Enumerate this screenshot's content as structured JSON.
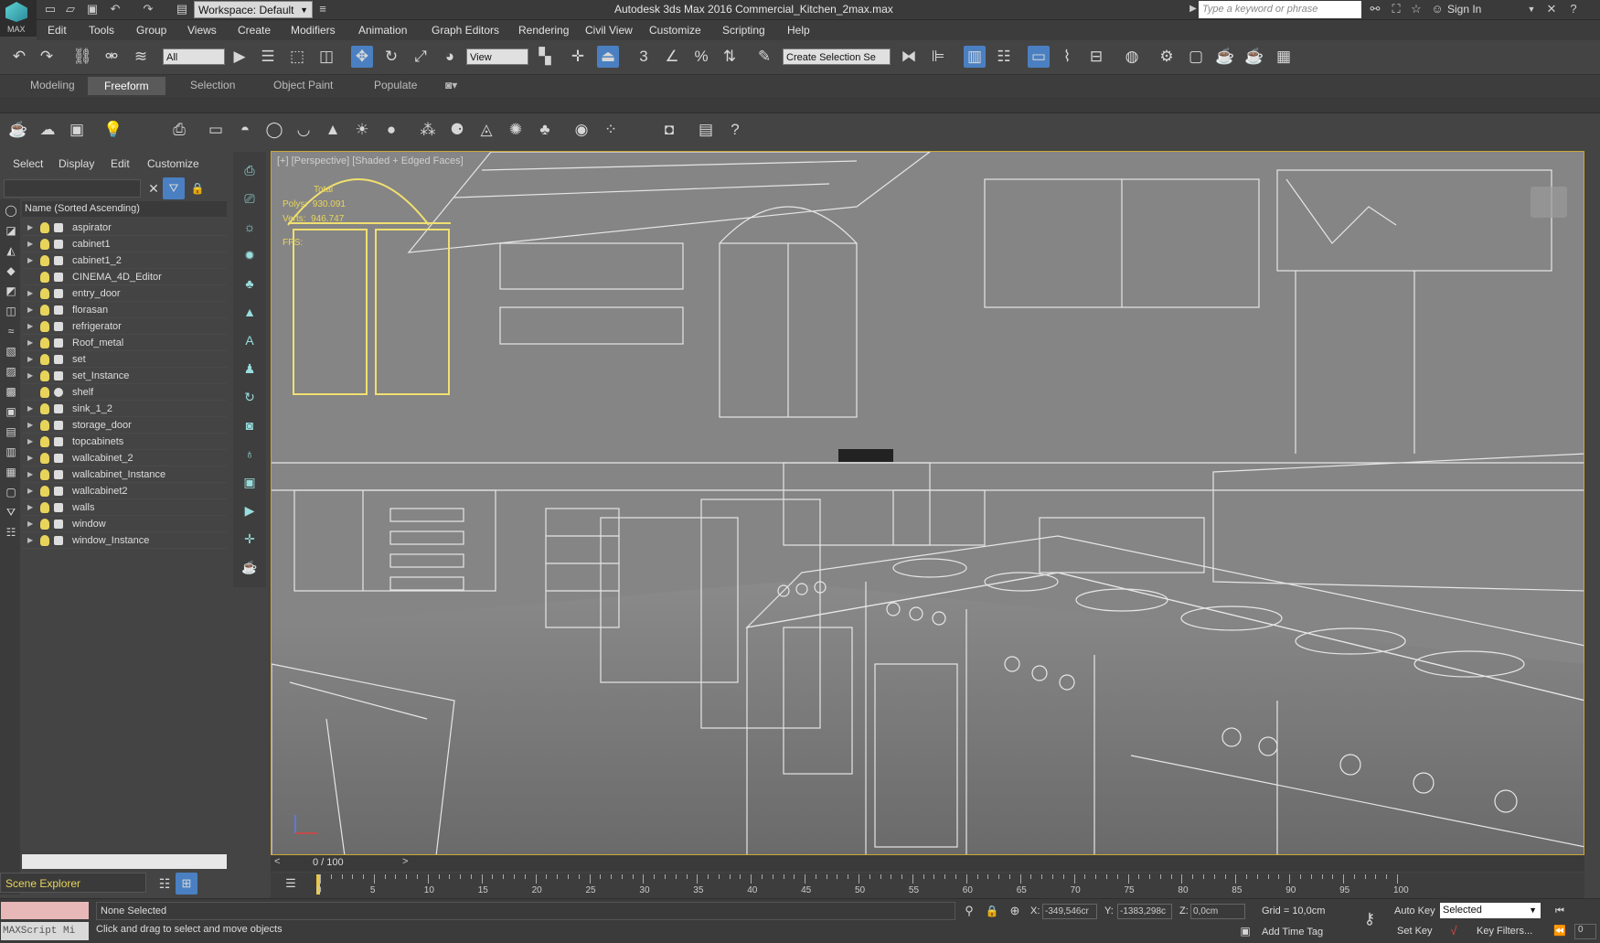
{
  "title_bar": {
    "app_logo_label": "MAX",
    "workspace": "Workspace: Default",
    "app_title": "Autodesk 3ds Max 2016     Commercial_Kitchen_2max.max",
    "search_placeholder": "Type a keyword or phrase",
    "sign_in": "Sign In"
  },
  "menu": [
    "Edit",
    "Tools",
    "Group",
    "Views",
    "Create",
    "Modifiers",
    "Animation",
    "Graph Editors",
    "Rendering",
    "Civil View",
    "Customize",
    "Scripting",
    "Help"
  ],
  "toolbar": {
    "selection_filter": "All",
    "ref_coord": "View",
    "named_selection_placeholder": "Create Selection Se",
    "snap_label": "3"
  },
  "ribbon_tabs": [
    "Modeling",
    "Freeform",
    "Selection",
    "Object Paint",
    "Populate"
  ],
  "ribbon_active": "Freeform",
  "explorer": {
    "tabs": [
      "Select",
      "Display",
      "Edit",
      "Customize"
    ],
    "column_header": "Name (Sorted Ascending)",
    "items": [
      "aspirator",
      "cabinet1",
      "cabinet1_2",
      "CINEMA_4D_Editor",
      "entry_door",
      "florasan",
      "refrigerator",
      "Roof_metal",
      "set",
      "set_Instance",
      "shelf",
      "sink_1_2",
      "storage_door",
      "topcabinets",
      "wallcabinet_2",
      "wallcabinet_Instance",
      "wallcabinet2",
      "walls",
      "window",
      "window_Instance"
    ],
    "footer_label": "Scene Explorer"
  },
  "viewport": {
    "label": "[+] [Perspective] [Shaded + Edged Faces]",
    "stats_total_label": "Total",
    "polys_label": "Polys:",
    "polys_value": "930.091",
    "verts_label": "Verts:",
    "verts_value": "946.747",
    "fps_label": "FPS:"
  },
  "timeline": {
    "frame_display": "0 / 100",
    "ticks": [
      "0",
      "5",
      "10",
      "15",
      "20",
      "25",
      "30",
      "35",
      "40",
      "45",
      "50",
      "55",
      "60",
      "65",
      "70",
      "75",
      "80",
      "85",
      "90",
      "95",
      "100"
    ]
  },
  "status": {
    "maxscript_label": "MAXScript Mi",
    "selection_status": "None Selected",
    "prompt": "Click and drag to select and move objects",
    "x_label": "X:",
    "x_value": "-349,546cr",
    "y_label": "Y:",
    "y_value": "-1383,298c",
    "z_label": "Z:",
    "z_value": "0,0cm",
    "grid": "Grid = 10,0cm",
    "add_time_tag": "Add Time Tag",
    "auto_key": "Auto Key",
    "set_key": "Set Key",
    "key_mode": "Selected",
    "key_filters": "Key Filters...",
    "frame_field": "0"
  },
  "colors": {
    "selection_highlight": "#e8d45a",
    "viewport_bg": "#7c7c7c",
    "active_button": "#4a80c2"
  }
}
